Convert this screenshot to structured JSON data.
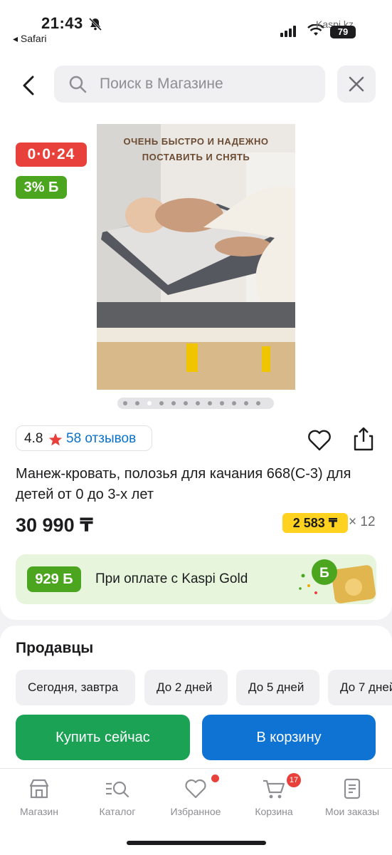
{
  "status_bar": {
    "time": "21:43",
    "back_app": "◂ Safari",
    "battery": "79",
    "watermark": "Kaspi.kz"
  },
  "search": {
    "placeholder": "Поиск в Магазине"
  },
  "product": {
    "timer": "0·0·24",
    "bonus_percent": "3% Б",
    "image_caption": "ОЧЕНЬ БЫСТРО И НАДЕЖНО ПОСТАВИТЬ И СНЯТЬ",
    "gallery_count": 12,
    "gallery_active_index": 2,
    "rating": "4.8",
    "reviews": "58 отзывов",
    "title": "Манеж-кровать, полозья для качания 668(С-3) для детей от 0 до 3-х лет",
    "price": "30 990 ₸",
    "installment_price": "2 583 ₸",
    "installment_months": "× 12"
  },
  "kaspi_gold": {
    "bonus": "929 Б",
    "text": "При оплате с Kaspi Gold"
  },
  "sellers": {
    "title": "Продавцы",
    "chips": [
      "Сегодня, завтра",
      "До 2 дней",
      "До 5 дней",
      "До 7 дней"
    ],
    "buy_now": "Купить сейчас",
    "add_to_cart": "В корзину"
  },
  "tabbar": {
    "items": [
      {
        "label": "Магазин",
        "icon": "shop-icon"
      },
      {
        "label": "Каталог",
        "icon": "catalog-icon"
      },
      {
        "label": "Избранное",
        "icon": "heart-icon"
      },
      {
        "label": "Корзина",
        "icon": "cart-icon"
      },
      {
        "label": "Мои заказы",
        "icon": "orders-icon"
      }
    ],
    "cart_count": "17"
  },
  "colors": {
    "accent_red": "#e8413b",
    "bonus_green": "#4ba51f",
    "buy_green": "#1ba255",
    "cart_blue": "#0f73d3",
    "installment_yellow": "#ffd21f",
    "link_blue": "#0a72c9"
  }
}
